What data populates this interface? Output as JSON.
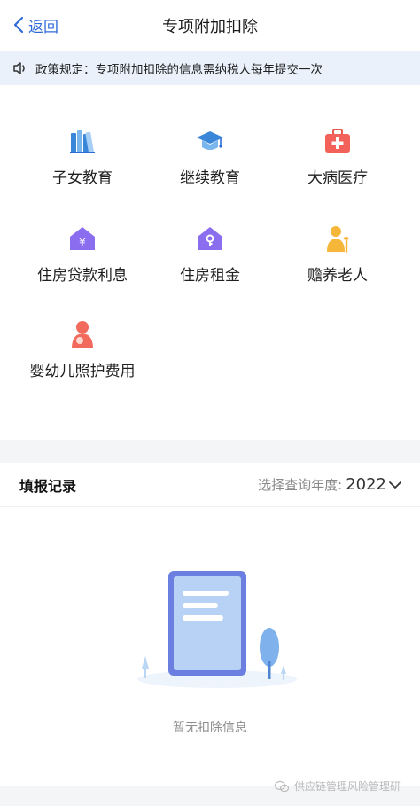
{
  "nav": {
    "back_label": "返回",
    "title": "专项附加扣除"
  },
  "notice": {
    "text": "政策规定：专项附加扣除的信息需纳税人每年提交一次"
  },
  "items": [
    {
      "label": "子女教育",
      "icon": "books-icon"
    },
    {
      "label": "继续教育",
      "icon": "graduation-cap-icon"
    },
    {
      "label": "大病医疗",
      "icon": "medical-kit-icon"
    },
    {
      "label": "住房贷款利息",
      "icon": "house-yen-icon"
    },
    {
      "label": "住房租金",
      "icon": "house-key-icon"
    },
    {
      "label": "赡养老人",
      "icon": "elderly-person-icon"
    },
    {
      "label": "婴幼儿照护费用",
      "icon": "mother-baby-icon"
    }
  ],
  "records": {
    "title": "填报记录",
    "year_label": "选择查询年度:",
    "year_value": "2022"
  },
  "empty": {
    "text": "暂无扣除信息"
  },
  "watermark": {
    "text": "供应链管理风险管理研"
  }
}
